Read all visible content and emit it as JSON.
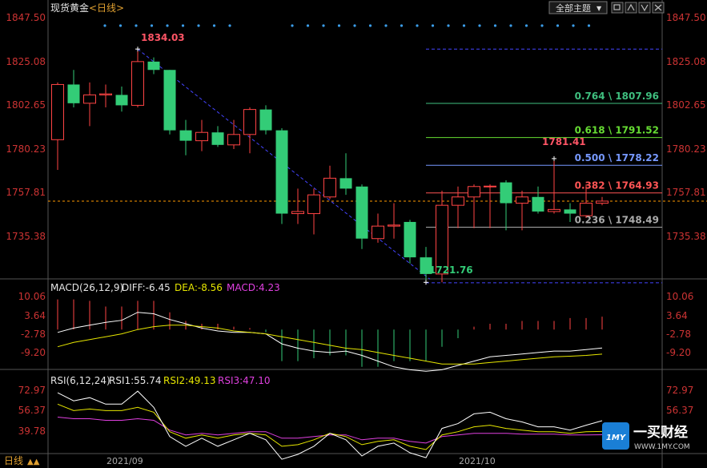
{
  "header": {
    "symbol": "现货黄金",
    "period": "<日线>",
    "theme_button": "全部主题",
    "footer_period": "日线",
    "footer_marker": "▲▲"
  },
  "watermark": {
    "brand": "一买财经",
    "url": "WWW.1MY.COM",
    "logo_text": "1MY"
  },
  "colors": {
    "up": "#ff4444",
    "down": "#33cc77",
    "axis_text": "#cc3333",
    "grid_line": "#444444",
    "ma_dash": "#ff9900",
    "fib_line": "#4444ff",
    "dot": "#3b9de8"
  },
  "price_axis": {
    "ticks": [
      "1847.50",
      "1825.08",
      "1802.65",
      "1780.23",
      "1757.81",
      "1735.38"
    ]
  },
  "price_markers": {
    "high": "1834.03",
    "low": "1721.76",
    "swing_high": "1781.41"
  },
  "current_price_line": 1761.0,
  "fibonacci": [
    {
      "label": "0.764 \\ 1807.96",
      "value": 1807.96,
      "color": "#3fbf7f"
    },
    {
      "label": "0.618 \\ 1791.52",
      "value": 1791.52,
      "color": "#66dd33"
    },
    {
      "label": "0.500 \\ 1778.22",
      "value": 1778.22,
      "color": "#7799ff"
    },
    {
      "label": "0.382 \\ 1764.93",
      "value": 1764.93,
      "color": "#ff5555"
    },
    {
      "label": "0.236 \\ 1748.49",
      "value": 1748.49,
      "color": "#aaaaaa"
    }
  ],
  "fib_extra_levels": [
    1834.03,
    1721.76
  ],
  "macd": {
    "title": "MACD(26,12,9)",
    "diff_label": "DIFF:-6.45",
    "dea_label": "DEA:-8.56",
    "macd_label": "MACD:4.23",
    "ticks": [
      "10.06",
      "3.64",
      "-2.78",
      "-9.20"
    ]
  },
  "rsi": {
    "title": "RSI(6,12,24)",
    "rsi1_label": "RSI1:55.74",
    "rsi2_label": "RSI2:49.13",
    "rsi3_label": "RSI3:47.10",
    "ticks": [
      "72.97",
      "56.37",
      "39.78"
    ]
  },
  "dates": [
    "2021/09",
    "2021/10"
  ],
  "chart_data": {
    "type": "candlestick",
    "price_ylim": [
      1722.5,
      1849.5
    ],
    "candles": [
      {
        "o": 1790.5,
        "h": 1818.0,
        "l": 1776.0,
        "c": 1817.0
      },
      {
        "o": 1817.0,
        "h": 1824.0,
        "l": 1806.0,
        "c": 1808.0
      },
      {
        "o": 1808.0,
        "h": 1818.0,
        "l": 1797.0,
        "c": 1812.0
      },
      {
        "o": 1812.0,
        "h": 1817.0,
        "l": 1806.0,
        "c": 1812.5
      },
      {
        "o": 1812.0,
        "h": 1816.0,
        "l": 1804.0,
        "c": 1807.0
      },
      {
        "o": 1807.0,
        "h": 1834.0,
        "l": 1806.0,
        "c": 1828.0
      },
      {
        "o": 1828.0,
        "h": 1830.0,
        "l": 1822.0,
        "c": 1824.0
      },
      {
        "o": 1824.0,
        "h": 1824.0,
        "l": 1793.0,
        "c": 1795.0
      },
      {
        "o": 1795.0,
        "h": 1800.0,
        "l": 1783.0,
        "c": 1790.0
      },
      {
        "o": 1790.0,
        "h": 1800.0,
        "l": 1785.0,
        "c": 1794.0
      },
      {
        "o": 1794.0,
        "h": 1797.0,
        "l": 1787.0,
        "c": 1788.0
      },
      {
        "o": 1788.0,
        "h": 1800.0,
        "l": 1786.0,
        "c": 1793.0
      },
      {
        "o": 1793.0,
        "h": 1806.0,
        "l": 1784.0,
        "c": 1805.0
      },
      {
        "o": 1805.0,
        "h": 1807.0,
        "l": 1793.0,
        "c": 1795.0
      },
      {
        "o": 1795.0,
        "h": 1796.0,
        "l": 1750.0,
        "c": 1755.0
      },
      {
        "o": 1755.0,
        "h": 1767.0,
        "l": 1750.0,
        "c": 1756.0
      },
      {
        "o": 1755.0,
        "h": 1767.0,
        "l": 1745.0,
        "c": 1764.0
      },
      {
        "o": 1763.0,
        "h": 1778.0,
        "l": 1762.0,
        "c": 1772.0
      },
      {
        "o": 1772.0,
        "h": 1784.0,
        "l": 1764.0,
        "c": 1767.0
      },
      {
        "o": 1768.0,
        "h": 1769.0,
        "l": 1738.0,
        "c": 1743.0
      },
      {
        "o": 1743.0,
        "h": 1755.0,
        "l": 1741.0,
        "c": 1749.0
      },
      {
        "o": 1749.0,
        "h": 1760.0,
        "l": 1743.0,
        "c": 1749.5
      },
      {
        "o": 1751.0,
        "h": 1752.0,
        "l": 1731.0,
        "c": 1734.0
      },
      {
        "o": 1734.0,
        "h": 1739.0,
        "l": 1722.0,
        "c": 1726.0
      },
      {
        "o": 1726.0,
        "h": 1766.0,
        "l": 1722.0,
        "c": 1759.0
      },
      {
        "o": 1759.0,
        "h": 1768.0,
        "l": 1748.0,
        "c": 1763.0
      },
      {
        "o": 1763.0,
        "h": 1769.0,
        "l": 1748.0,
        "c": 1768.0
      },
      {
        "o": 1768.0,
        "h": 1769.0,
        "l": 1748.0,
        "c": 1768.2
      },
      {
        "o": 1770.0,
        "h": 1771.0,
        "l": 1747.0,
        "c": 1760.0
      },
      {
        "o": 1760.0,
        "h": 1766.0,
        "l": 1747.0,
        "c": 1763.0
      },
      {
        "o": 1763.0,
        "h": 1768.0,
        "l": 1755.0,
        "c": 1756.0
      },
      {
        "o": 1756.0,
        "h": 1781.0,
        "l": 1755.0,
        "c": 1757.0
      },
      {
        "o": 1757.0,
        "h": 1760.0,
        "l": 1751.0,
        "c": 1755.0
      },
      {
        "o": 1754.0,
        "h": 1769.0,
        "l": 1753.0,
        "c": 1760.0
      },
      {
        "o": 1760.0,
        "h": 1763.0,
        "l": 1759.0,
        "c": 1761.0
      }
    ],
    "macd_ylim": [
      -12.5,
      11.5
    ],
    "macd_hist": [
      10.5,
      10.5,
      10.0,
      8.0,
      8.0,
      10.0,
      10.0,
      6.0,
      3.0,
      2.0,
      2.0,
      1.0,
      0.5,
      -1.0,
      -11.0,
      -11.0,
      -10.0,
      -9.0,
      -9.0,
      -13.0,
      -13.0,
      -11.0,
      -11.0,
      -11.0,
      -6.0,
      -3.0,
      1.0,
      2.0,
      2.0,
      3.0,
      3.0,
      3.0,
      4.0,
      4.0,
      4.5
    ],
    "macd_diff": [
      -1.0,
      0.5,
      1.5,
      2.5,
      3.2,
      6.0,
      5.5,
      3.5,
      2.0,
      0.5,
      -0.5,
      -1.0,
      -1.0,
      -1.5,
      -5.0,
      -6.5,
      -7.5,
      -8.0,
      -7.5,
      -9.0,
      -11.0,
      -13.0,
      -14.0,
      -14.5,
      -14.0,
      -12.5,
      -11.0,
      -9.5,
      -9.0,
      -8.5,
      -8.0,
      -7.5,
      -7.5,
      -7.0,
      -6.45
    ],
    "macd_dea": [
      -6.0,
      -4.5,
      -3.5,
      -2.5,
      -1.5,
      0.0,
      1.0,
      1.5,
      1.5,
      1.0,
      0.5,
      -0.5,
      -1.0,
      -1.5,
      -2.5,
      -3.5,
      -4.5,
      -5.5,
      -6.5,
      -7.0,
      -8.0,
      -9.0,
      -10.0,
      -11.0,
      -12.0,
      -12.0,
      -12.0,
      -11.5,
      -11.0,
      -10.5,
      -10.0,
      -9.5,
      -9.3,
      -9.0,
      -8.56
    ],
    "rsi_ylim": [
      36.0,
      78.0
    ],
    "rsi1": [
      73.0,
      68.0,
      70.0,
      66.0,
      66.0,
      74.0,
      64.0,
      46.0,
      40.0,
      45.0,
      40.0,
      44.0,
      48.0,
      44.0,
      32.0,
      35.0,
      40.0,
      48.0,
      44.0,
      34.0,
      40.0,
      42.0,
      36.0,
      33.0,
      51.0,
      54.0,
      60.0,
      61.0,
      57.0,
      55.0,
      52.0,
      52.0,
      50.0,
      53.0,
      55.74
    ],
    "rsi2": [
      66.0,
      62.0,
      63.0,
      62.0,
      62.0,
      64.0,
      61.0,
      49.0,
      45.0,
      47.0,
      45.0,
      47.0,
      48.0,
      47.0,
      40.0,
      41.0,
      44.0,
      48.0,
      46.0,
      41.0,
      43.0,
      44.0,
      40.0,
      38.0,
      47.0,
      49.0,
      52.0,
      53.0,
      51.0,
      50.0,
      49.0,
      49.0,
      48.0,
      49.0,
      49.13
    ],
    "rsi3": [
      58.0,
      57.0,
      57.0,
      56.0,
      56.0,
      57.0,
      56.0,
      50.0,
      47.0,
      48.0,
      47.0,
      48.0,
      49.0,
      49.0,
      45.0,
      45.0,
      46.0,
      47.0,
      47.0,
      44.0,
      45.0,
      45.0,
      43.0,
      42.0,
      46.0,
      47.0,
      48.0,
      48.0,
      48.0,
      47.5,
      47.5,
      47.5,
      47.0,
      47.0,
      47.1
    ]
  }
}
